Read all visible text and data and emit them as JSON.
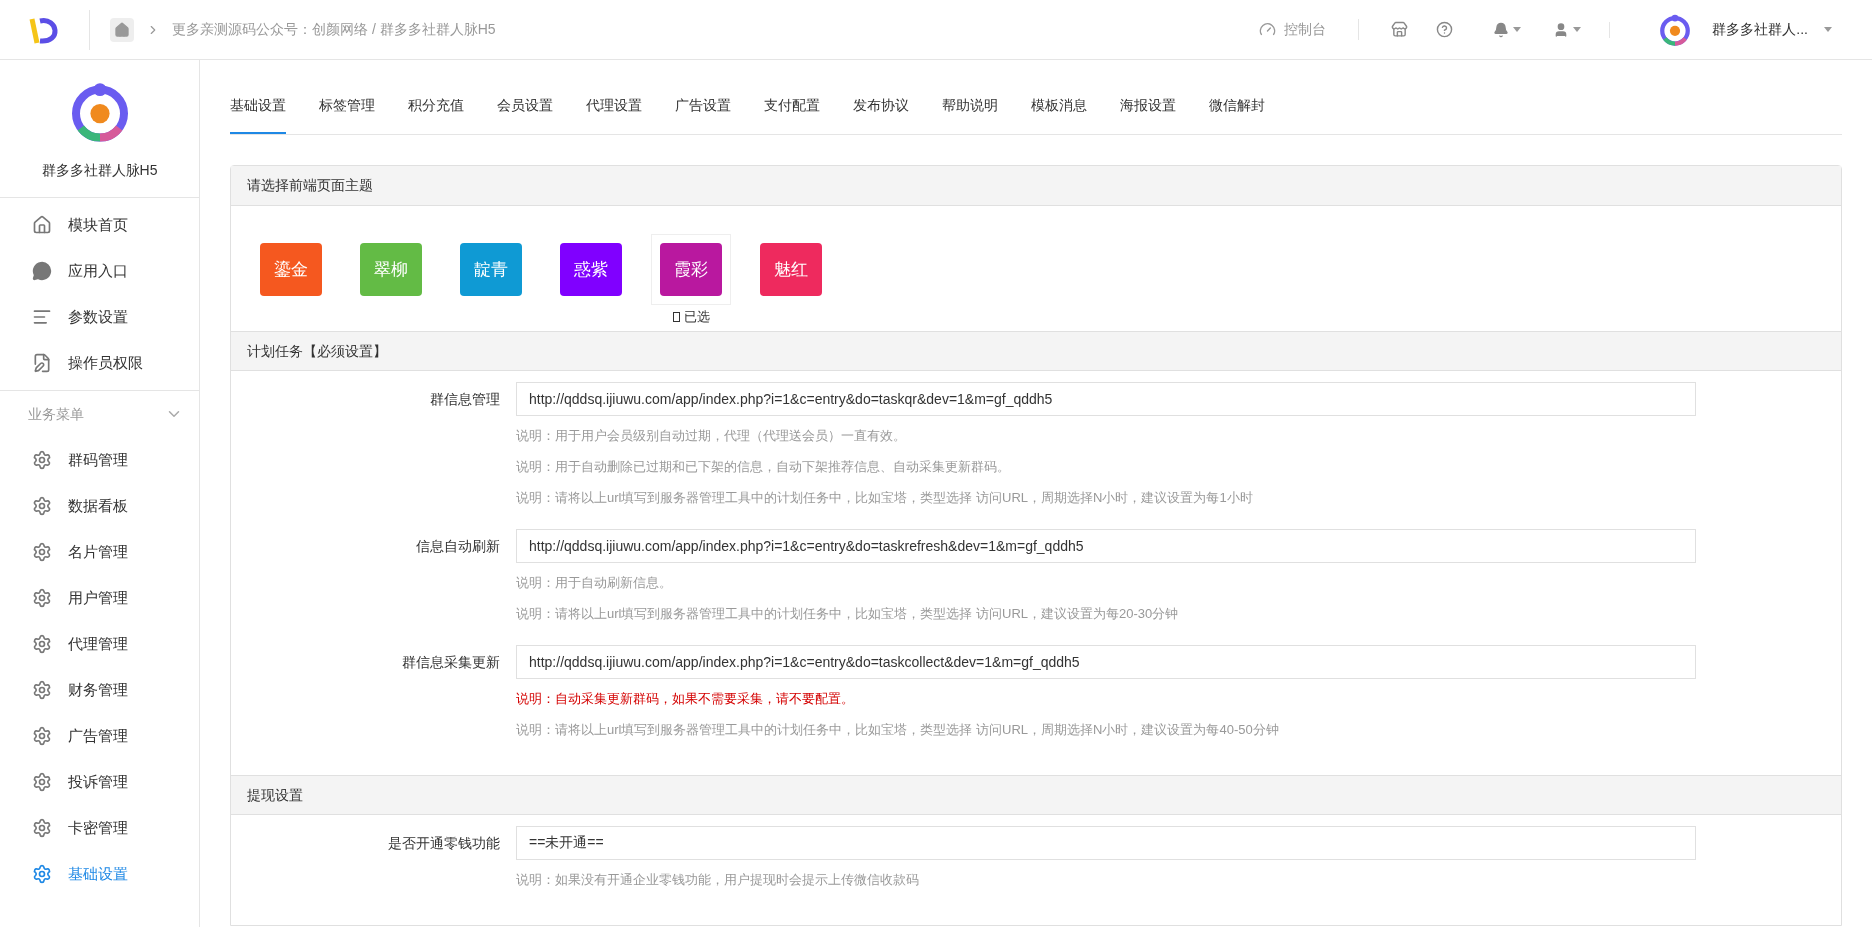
{
  "topbar": {
    "breadcrumb": "更多亲测源码公众号：创颜网络 / 群多多社群人脉H5",
    "console": "控制台",
    "account": "群多多社群人..."
  },
  "sidebar": {
    "app_name": "群多多社群人脉H5",
    "items": [
      {
        "label": "模块首页",
        "selected": false
      },
      {
        "label": "应用入口",
        "selected": false
      },
      {
        "label": "参数设置",
        "selected": false
      },
      {
        "label": "操作员权限",
        "selected": false
      }
    ],
    "section": {
      "title": "业务菜单",
      "expanded": true,
      "items": [
        {
          "label": "群码管理",
          "selected": false
        },
        {
          "label": "数据看板",
          "selected": false
        },
        {
          "label": "名片管理",
          "selected": false
        },
        {
          "label": "用户管理",
          "selected": false
        },
        {
          "label": "代理管理",
          "selected": false
        },
        {
          "label": "财务管理",
          "selected": false
        },
        {
          "label": "广告管理",
          "selected": false
        },
        {
          "label": "投诉管理",
          "selected": false
        },
        {
          "label": "卡密管理",
          "selected": false
        },
        {
          "label": "基础设置",
          "selected": true
        }
      ]
    }
  },
  "tabs": [
    {
      "label": "基础设置",
      "selected": true
    },
    {
      "label": "标签管理",
      "selected": false
    },
    {
      "label": "积分充值",
      "selected": false
    },
    {
      "label": "会员设置",
      "selected": false
    },
    {
      "label": "代理设置",
      "selected": false
    },
    {
      "label": "广告设置",
      "selected": false
    },
    {
      "label": "支付配置",
      "selected": false
    },
    {
      "label": "发布协议",
      "selected": false
    },
    {
      "label": "帮助说明",
      "selected": false
    },
    {
      "label": "模板消息",
      "selected": false
    },
    {
      "label": "海报设置",
      "selected": false
    },
    {
      "label": "微信解封",
      "selected": false
    }
  ],
  "theme_section": {
    "title": "请选择前端页面主题",
    "selected_label": "已选",
    "themes": [
      {
        "label": "鎏金",
        "color": "#f5581f",
        "selected": false
      },
      {
        "label": "翠柳",
        "color": "#63bb45",
        "selected": false
      },
      {
        "label": "靛青",
        "color": "#0f9ad4",
        "selected": false
      },
      {
        "label": "惑紫",
        "color": "#8000ff",
        "selected": false
      },
      {
        "label": "霞彩",
        "color": "#b9189f",
        "selected": true
      },
      {
        "label": "魅红",
        "color": "#ee2a5e",
        "selected": false
      }
    ]
  },
  "sections": [
    {
      "title": "计划任务【必须设置】",
      "fields": [
        {
          "label": "群信息管理",
          "value": "http://qddsq.ijiuwu.com/app/index.php?i=1&c=entry&do=taskqr&dev=1&m=gf_qddh5",
          "notes": [
            {
              "kind": "note",
              "text": "说明：用于用户会员级别自动过期，代理（代理送会员）一直有效。"
            },
            {
              "kind": "note",
              "text": "说明：用于自动删除已过期和已下架的信息，自动下架推荐信息、自动采集更新群码。"
            },
            {
              "kind": "note",
              "text": "说明：请将以上url填写到服务器管理工具中的计划任务中，比如宝塔，类型选择 访问URL，周期选择N小时，建议设置为每1小时"
            }
          ]
        },
        {
          "label": "信息自动刷新",
          "value": "http://qddsq.ijiuwu.com/app/index.php?i=1&c=entry&do=taskrefresh&dev=1&m=gf_qddh5",
          "notes": [
            {
              "kind": "note",
              "text": "说明：用于自动刷新信息。"
            },
            {
              "kind": "note",
              "text": "说明：请将以上url填写到服务器管理工具中的计划任务中，比如宝塔，类型选择 访问URL，建议设置为每20-30分钟"
            }
          ]
        },
        {
          "label": "群信息采集更新",
          "value": "http://qddsq.ijiuwu.com/app/index.php?i=1&c=entry&do=taskcollect&dev=1&m=gf_qddh5",
          "notes": [
            {
              "kind": "warning",
              "text": "说明：自动采集更新群码，如果不需要采集，请不要配置。"
            },
            {
              "kind": "note",
              "text": "说明：请将以上url填写到服务器管理工具中的计划任务中，比如宝塔，类型选择 访问URL，周期选择N小时，建议设置为每40-50分钟"
            }
          ]
        }
      ]
    },
    {
      "title": "提现设置",
      "fields": [
        {
          "label": "是否开通零钱功能",
          "value": "==未开通==",
          "notes": [
            {
              "kind": "note",
              "text": "说明：如果没有开通企业零钱功能，用户提现时会提示上传微信收款码"
            }
          ]
        }
      ]
    }
  ]
}
